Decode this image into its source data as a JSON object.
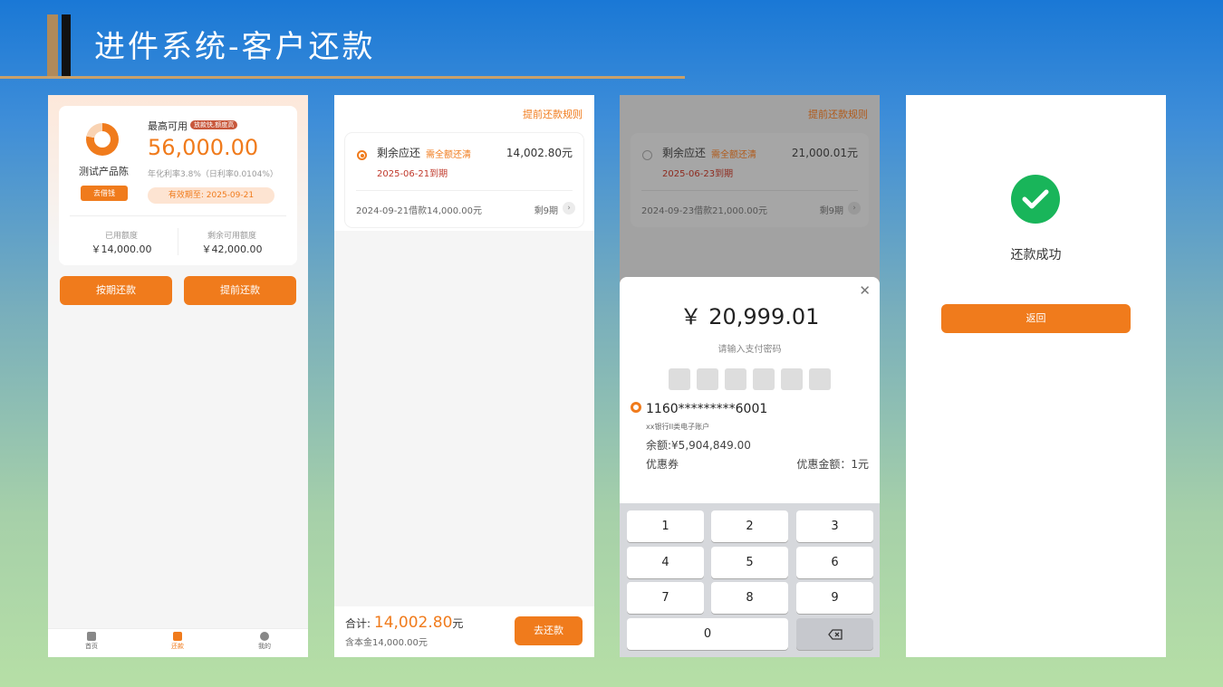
{
  "header": {
    "title": "进件系统-客户还款"
  },
  "screen1": {
    "product_name": "测试产品陈",
    "borrow_label": "去借钱",
    "max_label": "最高可用",
    "tag": "放款快,额度高",
    "amount": "56,000.00",
    "rate": "年化利率3.8%（日利率0.0104%）",
    "valid": "有效期至: 2025-09-21",
    "used_label": "已用额度",
    "used_value": "￥14,000.00",
    "remain_label": "剩余可用额度",
    "remain_value": "￥42,000.00",
    "btn_scheduled": "按期还款",
    "btn_early": "提前还款",
    "tabs": [
      "首页",
      "还款",
      "我的"
    ]
  },
  "screen2": {
    "rule_link": "提前还款规则",
    "remain_label": "剩余应还",
    "clear_note": "需全额还清",
    "amount": "14,002.80元",
    "due": "2025-06-21到期",
    "loan": "2024-09-21借款14,000.00元",
    "period": "剩9期",
    "total_label": "合计:",
    "total_amount": "14,002.80",
    "total_unit": "元",
    "principal": "含本金14,000.00元",
    "pay_button": "去还款"
  },
  "screen3": {
    "rule_link": "提前还款规则",
    "remain_label": "剩余应还",
    "clear_note": "需全额还清",
    "amount": "21,000.01元",
    "due": "2025-06-23到期",
    "loan": "2024-09-23借款21,000.00元",
    "period": "剩9期",
    "pay_amount": "￥ 20,999.01",
    "pw_label": "请输入支付密码",
    "card_no": "1160*********6001",
    "bank": "xx银行II类电子账户",
    "balance": "余额:¥5,904,849.00",
    "coupon": "优惠券",
    "discount": "优惠金额：1元",
    "keys": [
      "1",
      "2",
      "3",
      "4",
      "5",
      "6",
      "7",
      "8",
      "9",
      "0"
    ]
  },
  "screen4": {
    "success": "还款成功",
    "back_button": "返回"
  },
  "colors": {
    "accent": "#f07b1c",
    "success": "#19b55a"
  }
}
